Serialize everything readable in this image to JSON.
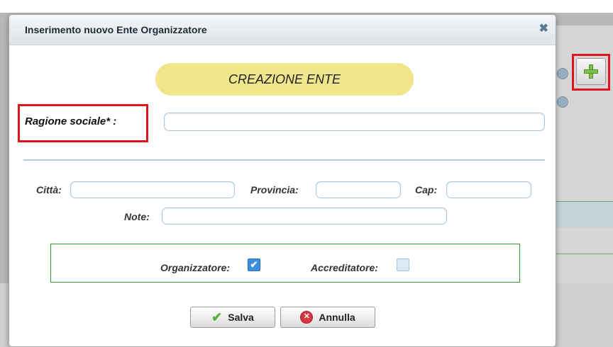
{
  "dialog": {
    "title": "Inserimento nuovo Ente Organizzatore",
    "close_symbol": "✖",
    "header_pill": "CREAZIONE ENTE"
  },
  "form": {
    "ragione_sociale_label": "Ragione sociale* :",
    "ragione_sociale_value": "",
    "citta_label": "Città:",
    "citta_value": "",
    "provincia_label": "Provincia:",
    "provincia_value": "",
    "cap_label": "Cap:",
    "cap_value": "",
    "note_label": "Note:",
    "note_value": ""
  },
  "roles": {
    "organizzatore_label": "Organizzatore:",
    "organizzatore_checked": true,
    "accreditatore_label": "Accreditatore:",
    "accreditatore_checked": false
  },
  "buttons": {
    "save_label": "Salva",
    "cancel_label": "Annulla"
  },
  "icons": {
    "close": "close-icon",
    "add": "plus-icon",
    "save": "checkmark-icon",
    "cancel": "cancel-circle-icon"
  },
  "colors": {
    "pill": "#f0e68c",
    "highlight": "#e0141e",
    "role_border": "#2f9a2f",
    "checkbox_checked": "#3d8fe0"
  }
}
